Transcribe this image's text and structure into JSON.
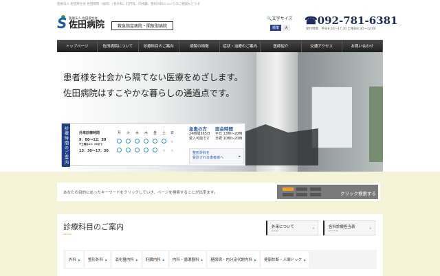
{
  "tagline": "医療法人 佐田厚生会 佐田病院（福岡）| 各外科、肛門科、内視鏡、整形外科についてのご相談もどうぞ",
  "logo": {
    "sub": "医療法人 佐田厚生会",
    "name": "佐田病院"
  },
  "badge": "救急指定病院・開放型病院",
  "font_size": {
    "label": "文字サイズ",
    "options": [
      "標準",
      "大"
    ],
    "selected": "標準"
  },
  "phone": {
    "number": "☎092-781-6381",
    "hours": "受付時間　平日8:30〜17:30 土曜日8:30〜12:00"
  },
  "nav": [
    "トップページ",
    "佐田病院について",
    "診療科目のご案内",
    "病院の特徴",
    "症状・治療のご案内",
    "医師紹介",
    "交通アクセス",
    "お問い合わせ"
  ],
  "hero": {
    "line1": "患者様を社会から隔てない医療をめざします。",
    "line2": "佐田病院はすこやかな暮らしの通過点です。"
  },
  "schedule": {
    "tab": "診療時間のご案内",
    "header": "外来診療時間",
    "days": [
      "月",
      "火",
      "水",
      "木",
      "金",
      "土",
      "日"
    ],
    "rows": [
      {
        "time": "9：00〜12：30",
        "note": "※土曜は12：00まで",
        "marks": [
          "o",
          "o",
          "o",
          "o",
          "o",
          "o",
          "x"
        ]
      },
      {
        "time": "13：30〜17：30",
        "note": "",
        "marks": [
          "o",
          "o",
          "o",
          "o",
          "o",
          "x",
          "x"
        ]
      }
    ]
  },
  "emergency": {
    "title": "急患の方",
    "line1": "24時間365日",
    "line2": "受入可能です"
  },
  "visiting": {
    "title": "面会時間",
    "line1": "平日 13時〜20時",
    "line2": "日祝 10時〜20時"
  },
  "ortho_link": {
    "line1": "整形外科を",
    "line2": "受診される患者様へ",
    "arrow": "▸"
  },
  "search": {
    "text": "あなたの目的にあったキーワードをクリックしていき、ページを検索することが出来ます。",
    "button": "クリック検索する"
  },
  "section": {
    "title": "診療科目のご案内",
    "subtitle": "services",
    "links": [
      {
        "label": "外来について",
        "sub": "Design"
      },
      {
        "label": "各科診療担当表",
        "sub": "schedule"
      }
    ],
    "departments": [
      "外科",
      "整形外科",
      "消化器内科",
      "肝臓内科",
      "内科・循環器科",
      "糖尿病・内分泌代謝内科",
      "健康診断・人間ドック"
    ]
  },
  "colors": {
    "nav": "#2a2a2a",
    "accent": "#1f3f86",
    "background": "#f4f3d8"
  }
}
